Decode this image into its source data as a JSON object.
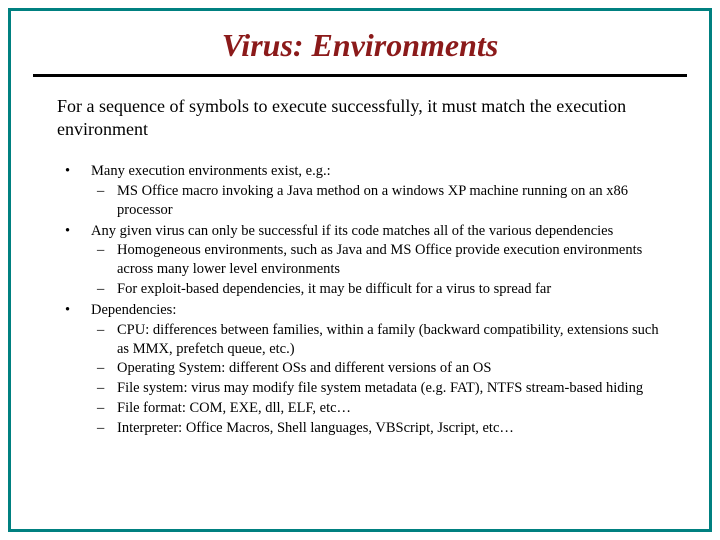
{
  "title": "Virus: Environments",
  "intro": "For a sequence of symbols to execute successfully, it must match the execution environment",
  "bullets": [
    {
      "text": "Many execution environments exist, e.g.:",
      "subs": [
        "MS Office macro invoking a Java method on a windows XP machine running on an x86 processor"
      ]
    },
    {
      "text": "Any given virus can only be successful if its code matches all of the various dependencies",
      "subs": [
        "Homogeneous environments, such as Java and MS Office provide execution environments across many lower level environments",
        "For exploit-based dependencies, it may be difficult for a virus to spread far"
      ]
    },
    {
      "text": "Dependencies:",
      "subs": [
        "CPU: differences between families, within a family (backward compatibility, extensions such as MMX, prefetch queue, etc.)",
        "Operating System: different OSs and different versions of an OS",
        "File system: virus may modify file system metadata (e.g. FAT), NTFS stream-based hiding",
        "File format: COM, EXE, dll, ELF, etc…",
        "Interpreter: Office Macros, Shell languages, VBScript, Jscript, etc…"
      ]
    }
  ]
}
